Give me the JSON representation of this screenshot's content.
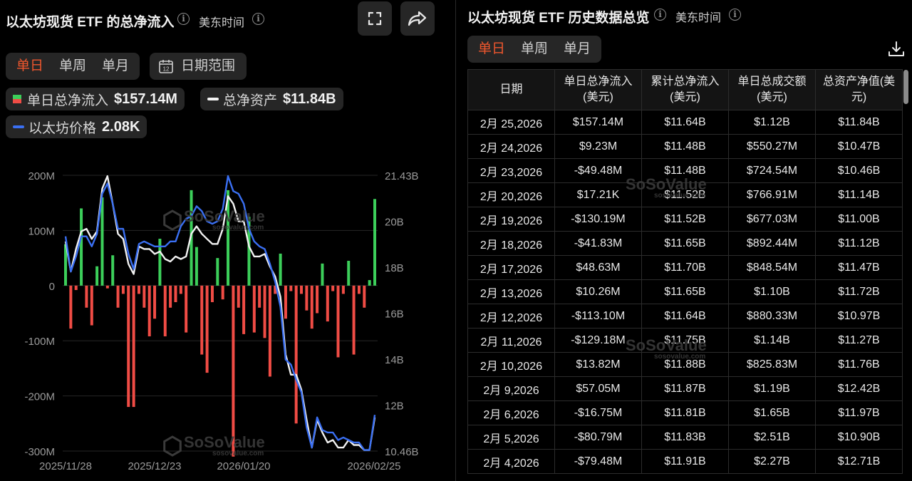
{
  "left_panel": {
    "title": "以太坊现货 ETF 的总净流入",
    "timezone": "美东时间",
    "tabs": [
      "单日",
      "单周",
      "单月"
    ],
    "active_tab": "单日",
    "date_range_label": "日期范围",
    "calendar_day": "12",
    "legend": {
      "daily_inflow_label": "单日总净流入",
      "daily_inflow_value": "$157.14M",
      "net_assets_label": "总净资产",
      "net_assets_value": "$11.84B",
      "eth_price_label": "以太坊价格",
      "eth_price_value": "2.08K"
    }
  },
  "right_panel": {
    "title": "以太坊现货 ETF 历史数据总览",
    "timezone": "美东时间",
    "tabs": [
      "单日",
      "单周",
      "单月"
    ],
    "active_tab": "单日",
    "columns": [
      "日期",
      "单日总净流入(美元)",
      "累计总净流入(美元)",
      "单日总成交额(美元)",
      "总资产净值(美元)"
    ],
    "rows": [
      {
        "date": "2月 25,2026",
        "inflow": "$157.14M",
        "cum": "$11.64B",
        "volume": "$1.12B",
        "nav": "$11.84B"
      },
      {
        "date": "2月 24,2026",
        "inflow": "$9.23M",
        "cum": "$11.48B",
        "volume": "$550.27M",
        "nav": "$10.47B"
      },
      {
        "date": "2月 23,2026",
        "inflow": "-$49.48M",
        "cum": "$11.48B",
        "volume": "$724.54M",
        "nav": "$10.46B"
      },
      {
        "date": "2月 20,2026",
        "inflow": "$17.21K",
        "cum": "$11.52B",
        "volume": "$766.91M",
        "nav": "$11.14B"
      },
      {
        "date": "2月 19,2026",
        "inflow": "-$130.19M",
        "cum": "$11.52B",
        "volume": "$677.03M",
        "nav": "$11.00B"
      },
      {
        "date": "2月 18,2026",
        "inflow": "-$41.83M",
        "cum": "$11.65B",
        "volume": "$892.44M",
        "nav": "$11.12B"
      },
      {
        "date": "2月 17,2026",
        "inflow": "$48.63M",
        "cum": "$11.70B",
        "volume": "$848.54M",
        "nav": "$11.47B"
      },
      {
        "date": "2月 13,2026",
        "inflow": "$10.26M",
        "cum": "$11.65B",
        "volume": "$1.10B",
        "nav": "$11.72B"
      },
      {
        "date": "2月 12,2026",
        "inflow": "-$113.10M",
        "cum": "$11.64B",
        "volume": "$880.33M",
        "nav": "$10.97B"
      },
      {
        "date": "2月 11,2026",
        "inflow": "-$129.18M",
        "cum": "$11.75B",
        "volume": "$1.14B",
        "nav": "$11.27B"
      },
      {
        "date": "2月 10,2026",
        "inflow": "$13.82M",
        "cum": "$11.88B",
        "volume": "$825.83M",
        "nav": "$11.76B"
      },
      {
        "date": "2月 9,2026",
        "inflow": "$57.05M",
        "cum": "$11.87B",
        "volume": "$1.19B",
        "nav": "$12.42B"
      },
      {
        "date": "2月 6,2026",
        "inflow": "-$16.75M",
        "cum": "$11.81B",
        "volume": "$1.65B",
        "nav": "$11.97B"
      },
      {
        "date": "2月 5,2026",
        "inflow": "-$80.79M",
        "cum": "$11.83B",
        "volume": "$2.51B",
        "nav": "$10.90B"
      },
      {
        "date": "2月 4,2026",
        "inflow": "-$79.48M",
        "cum": "$11.91B",
        "volume": "$2.27B",
        "nav": "$12.71B"
      }
    ]
  },
  "watermark": {
    "brand": "SoSoValue",
    "site": "sosovalue.com"
  },
  "chart_data": {
    "type": "bar",
    "y_left_ticks": [
      "200M",
      "100M",
      "0",
      "-100M",
      "-200M",
      "-300M"
    ],
    "y_left_range": [
      -300,
      200
    ],
    "y_right_ticks": [
      "21.43B",
      "20B",
      "18B",
      "16B",
      "14B",
      "12B",
      "10.46B"
    ],
    "y_right_range": [
      10.46,
      21.43
    ],
    "x_tick_labels": [
      "2025/11/28",
      "2025/12/23",
      "2026/01/20",
      "2026/02/25"
    ],
    "series": [
      {
        "name": "单日总净流入",
        "kind": "bar",
        "color_pos": "#3ccf5a",
        "color_neg": "#f04c45",
        "values": [
          75,
          -78,
          -8,
          140,
          -40,
          -72,
          35,
          160,
          -5,
          55,
          -40,
          -15,
          -220,
          -220,
          -15,
          -40,
          -92,
          -60,
          85,
          -92,
          -40,
          -30,
          -15,
          -85,
          173,
          70,
          -125,
          -158,
          -30,
          50,
          -25,
          173,
          -310,
          -40,
          -88,
          125,
          -85,
          -40,
          -95,
          -165,
          -15,
          58,
          -60,
          -10,
          -250,
          -15,
          -45,
          -78,
          -50,
          40,
          -65,
          -10,
          -130,
          -15,
          45,
          -125,
          -15,
          -40,
          10,
          157
        ]
      },
      {
        "name": "总净资产",
        "kind": "line",
        "color": "#f2f2f2",
        "values": [
          18.8,
          17.6,
          18.5,
          19.2,
          19.3,
          18.9,
          19.2,
          20.9,
          21.4,
          20.3,
          19.1,
          18.9,
          17.9,
          17.5,
          18.6,
          18.5,
          18.5,
          18.3,
          18.4,
          18.1,
          18.0,
          18.2,
          18.1,
          18.2,
          19.1,
          19.4,
          19.1,
          18.9,
          18.7,
          18.7,
          19.3,
          20.6,
          20.3,
          19.6,
          19.6,
          18.6,
          18.2,
          18.2,
          18.3,
          17.8,
          17.4,
          16.6,
          14.3,
          13.5,
          13.5,
          12.9,
          11.7,
          10.6,
          11.7,
          11.2,
          10.8,
          10.9,
          10.6,
          10.6,
          10.9,
          10.7,
          10.7,
          10.5,
          10.5,
          11.8
        ]
      },
      {
        "name": "以太坊价格",
        "kind": "line",
        "color": "#3a6ff2",
        "values": [
          19.0,
          17.6,
          18.2,
          19.0,
          19.0,
          18.6,
          19.1,
          20.7,
          21.1,
          20.3,
          19.3,
          19.3,
          18.3,
          17.7,
          18.7,
          18.8,
          18.7,
          18.6,
          18.6,
          18.6,
          18.8,
          18.8,
          19.4,
          19.7,
          19.8,
          20.2,
          20.0,
          19.6,
          19.5,
          19.6,
          20.1,
          21.4,
          20.8,
          20.7,
          20.3,
          19.3,
          18.8,
          18.6,
          18.5,
          17.9,
          17.2,
          16.2,
          14.1,
          13.9,
          13.3,
          12.8,
          11.4,
          10.6,
          11.8,
          11.3,
          11.2,
          11.2,
          10.9,
          11.0,
          10.9,
          10.8,
          10.8,
          10.5,
          10.5,
          11.9
        ]
      }
    ]
  }
}
